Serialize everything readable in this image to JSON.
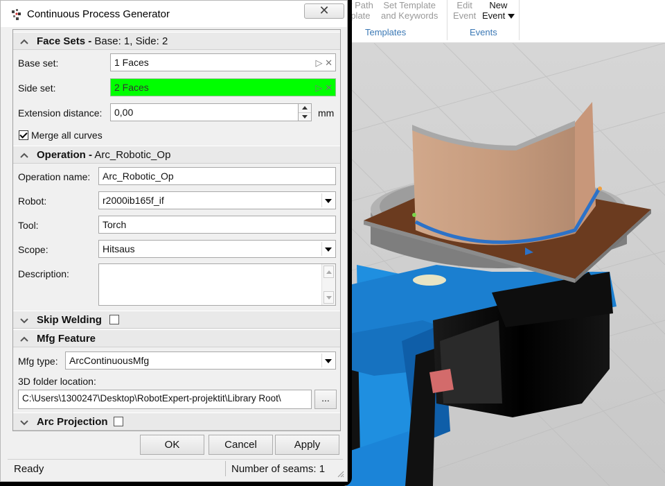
{
  "window": {
    "title": "Continuous Process Generator",
    "close_glyph": "✕"
  },
  "background_app": {
    "ribbon": {
      "btn1_line1": "y Path",
      "btn1_line2": "plate",
      "btn2_line1": "Set Template",
      "btn2_line2": "and Keywords",
      "btn3_line1": "Edit",
      "btn3_line2": "Event",
      "btn4_line1": "New",
      "btn4_line2": "Event",
      "group_templates": "Templates",
      "group_events": "Events"
    }
  },
  "face_sets": {
    "title": "Face Sets -",
    "subtitle": " Base: 1, Side: 2",
    "base_set_label": "Base set:",
    "base_set_value": "1 Faces",
    "side_set_label": "Side set:",
    "side_set_value": "2 Faces",
    "extension_label": "Extension distance:",
    "extension_value": "0,00",
    "extension_unit": "mm",
    "merge_label": "Merge all curves",
    "merge_checked": true
  },
  "operation": {
    "title": "Operation -",
    "subtitle": " Arc_Robotic_Op",
    "name_label": "Operation name:",
    "name_value": "Arc_Robotic_Op",
    "robot_label": "Robot:",
    "robot_value": "r2000ib165f_if",
    "tool_label": "Tool:",
    "tool_value": "Torch",
    "scope_label": "Scope:",
    "scope_value": "Hitsaus",
    "description_label": "Description:",
    "description_value": ""
  },
  "skip_welding": {
    "title": "Skip Welding",
    "checked": false
  },
  "mfg_feature": {
    "title": "Mfg Feature",
    "type_label": "Mfg type:",
    "type_value": "ArcContinuousMfg",
    "folder_label": "3D folder location:",
    "folder_value": "C:\\Users\\1300247\\Desktop\\RobotExpert-projektit\\Library Root\\",
    "browse_label": "..."
  },
  "arc_projection": {
    "title": "Arc Projection",
    "checked": false
  },
  "buttons": {
    "ok": "OK",
    "cancel": "Cancel",
    "apply": "Apply"
  },
  "status": {
    "ready": "Ready",
    "seams": "Number of seams:  1"
  },
  "icons": {
    "clear_glyph": "✕",
    "pick_glyph": "▷"
  },
  "colors": {
    "side_set_highlight": "#00ff00",
    "ribbon_group": "#3a78b5"
  }
}
